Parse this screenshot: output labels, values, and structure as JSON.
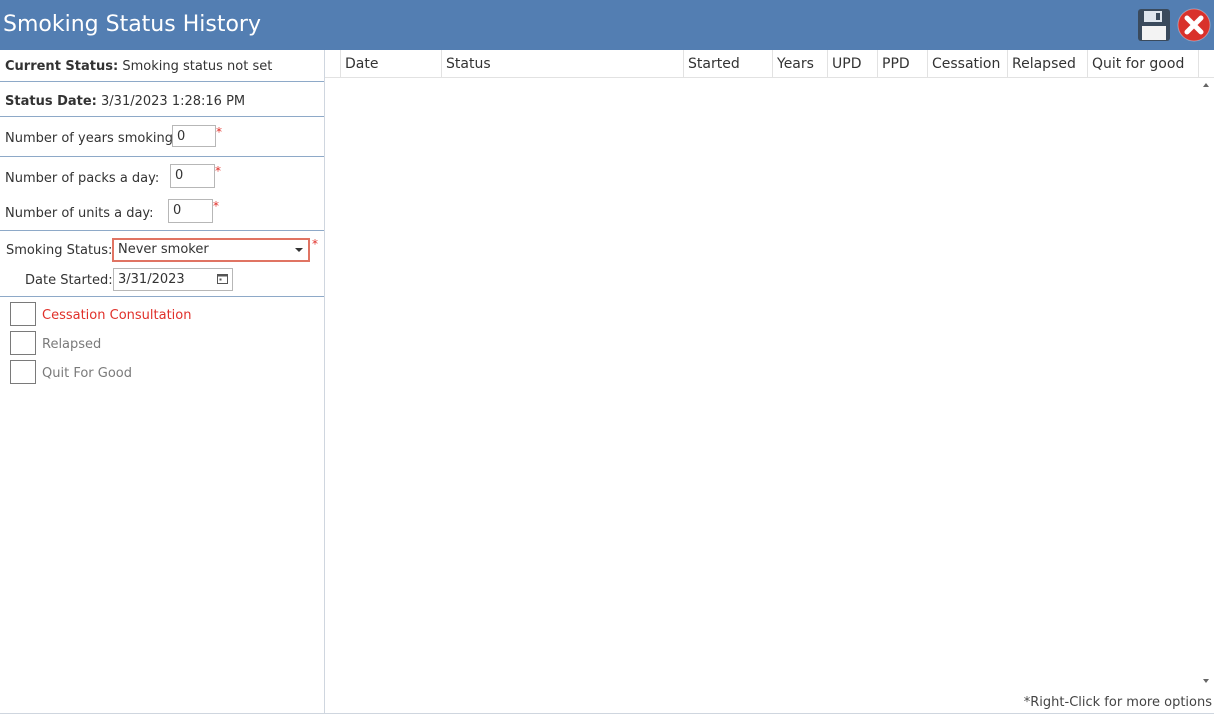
{
  "window": {
    "title": "Smoking Status History"
  },
  "toolbar": {
    "save_icon": "save-icon",
    "close_icon": "close-icon"
  },
  "left": {
    "current_status": {
      "label": "Current Status:",
      "value": "Smoking status not set"
    },
    "status_date": {
      "label": "Status Date:",
      "value": "3/31/2023 1:28:16 PM"
    },
    "years_smoking": {
      "label": "Number of years smoking:",
      "value": "0"
    },
    "packs_day": {
      "label": "Number of packs a day:",
      "value": "0"
    },
    "units_day": {
      "label": "Number of units a day:",
      "value": "0"
    },
    "smoking_status": {
      "label": "Smoking Status:",
      "value": "Never smoker"
    },
    "date_started": {
      "label": "Date Started:",
      "value": "3/31/2023"
    },
    "required_mark": "*",
    "checkboxes": [
      {
        "label": "Cessation Consultation",
        "checked": false,
        "color": "#e0302a"
      },
      {
        "label": "Relapsed",
        "checked": false
      },
      {
        "label": "Quit For Good",
        "checked": false
      }
    ]
  },
  "grid": {
    "columns": [
      "Date",
      "Status",
      "Started",
      "Years",
      "UPD",
      "PPD",
      "Cessation",
      "Relapsed",
      "Quit for good"
    ],
    "rows": [],
    "footnote": "*Right-Click for more options"
  },
  "colors": {
    "titlebar": "#537eb2",
    "required": "#e0302a",
    "highlight": "#e07463"
  }
}
